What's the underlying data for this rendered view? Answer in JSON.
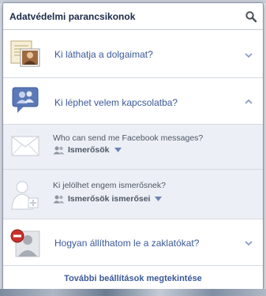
{
  "header": {
    "title": "Adatvédelmi parancsikonok"
  },
  "rows": [
    {
      "label": "Ki láthatja a dolgaimat?"
    },
    {
      "label": "Ki léphet velem kapcsolatba?"
    },
    {
      "label": "Hogyan állíthatom le a zaklatókat?"
    }
  ],
  "contact_options": [
    {
      "question": "Who can send me Facebook messages?",
      "value": "Ismerősök"
    },
    {
      "question": "Ki jelölhet engem ismerősnek?",
      "value": "Ismerősök ismerősei"
    }
  ],
  "footer": {
    "link": "További beállítások megtekintése"
  },
  "colors": {
    "link": "#3b5998",
    "muted_text": "#4e5665",
    "sub_bg": "#eceff5"
  }
}
